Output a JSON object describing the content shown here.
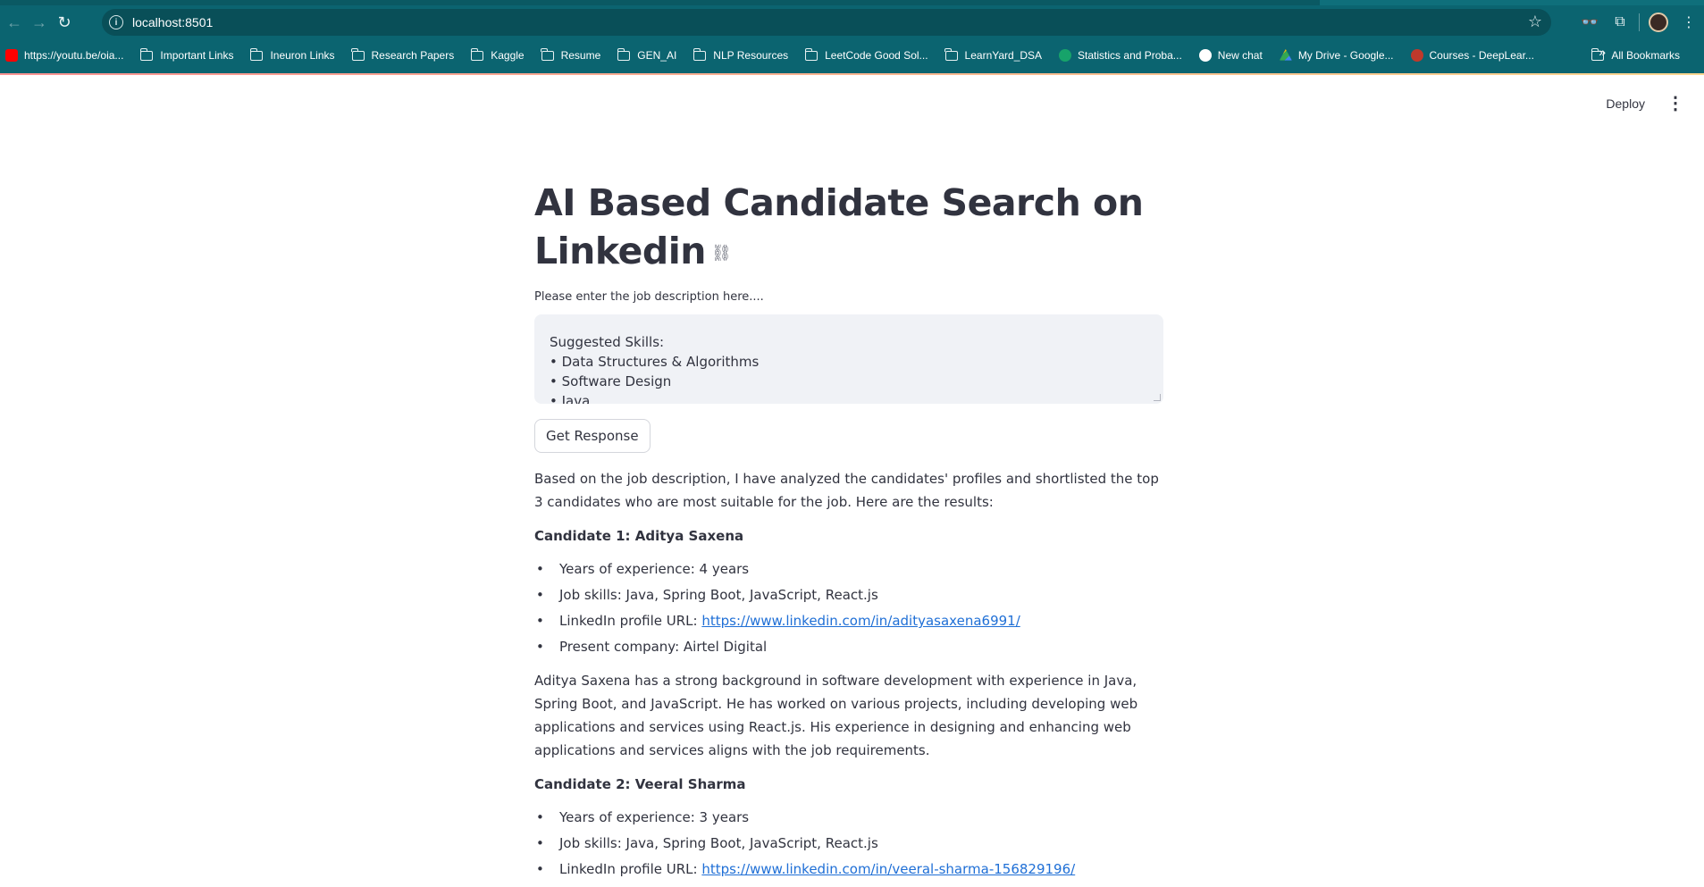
{
  "browser": {
    "url": "localhost:8501",
    "bookmarks": [
      {
        "label": "https://youtu.be/oia...",
        "icon": "youtube-icon"
      },
      {
        "label": "Important Links",
        "icon": "folder-icon"
      },
      {
        "label": "Ineuron Links",
        "icon": "folder-icon"
      },
      {
        "label": "Research Papers",
        "icon": "folder-icon"
      },
      {
        "label": "Kaggle",
        "icon": "folder-icon"
      },
      {
        "label": "Resume",
        "icon": "folder-icon"
      },
      {
        "label": "GEN_AI",
        "icon": "folder-icon"
      },
      {
        "label": "NLP Resources",
        "icon": "folder-icon"
      },
      {
        "label": "LeetCode Good Sol...",
        "icon": "folder-icon"
      },
      {
        "label": "LearnYard_DSA",
        "icon": "folder-icon"
      },
      {
        "label": "Statistics and Proba...",
        "icon": "statistics-icon"
      },
      {
        "label": "New chat",
        "icon": "chatgpt-icon"
      },
      {
        "label": "My Drive - Google...",
        "icon": "google-drive-icon"
      },
      {
        "label": "Courses - DeepLear...",
        "icon": "deeplearning-icon"
      }
    ],
    "all_bookmarks": "All Bookmarks"
  },
  "app_header": {
    "deploy": "Deploy"
  },
  "main": {
    "title": "AI Based Candidate Search on Linkedin",
    "input_label": "Please enter the job description here....",
    "textarea_lines": [
      "Suggested Skills:",
      "• Data Structures & Algorithms",
      "• Software Design",
      "• Java"
    ],
    "button_label": "Get Response",
    "intro": "Based on the job description, I have analyzed the candidates' profiles and shortlisted the top 3 candidates who are most suitable for the job. Here are the results:",
    "candidates": [
      {
        "heading": "Candidate 1: Aditya Saxena",
        "experience": "Years of experience: 4 years",
        "skills": "Job skills: Java, Spring Boot, JavaScript, React.js",
        "linkedin_label": "LinkedIn profile URL: ",
        "linkedin_url": "https://www.linkedin.com/in/adityasaxena6991/",
        "company": "Present company: Airtel Digital",
        "summary": "Aditya Saxena has a strong background in software development with experience in Java, Spring Boot, and JavaScript. He has worked on various projects, including developing web applications and services using React.js. His experience in designing and enhancing web applications and services aligns with the job requirements."
      },
      {
        "heading": "Candidate 2: Veeral Sharma",
        "experience": "Years of experience: 3 years",
        "skills": "Job skills: Java, Spring Boot, JavaScript, React.js",
        "linkedin_label": "LinkedIn profile URL: ",
        "linkedin_url": "https://www.linkedin.com/in/veeral-sharma-156829196/"
      }
    ]
  }
}
